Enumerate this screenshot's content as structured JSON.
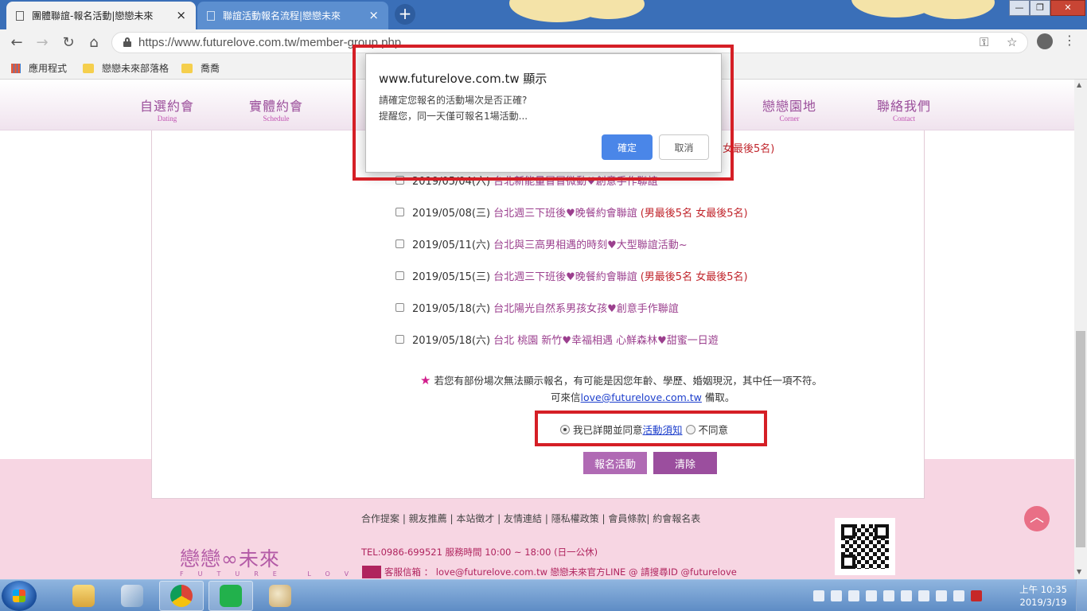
{
  "browser": {
    "tabs": [
      {
        "label": "團體聯誼-報名活動|戀戀未來",
        "active": true
      },
      {
        "label": "聯誼活動報名流程|戀戀未來",
        "active": false
      }
    ],
    "tab_close": "×",
    "new_tab": "+",
    "window_buttons": {
      "minimize": "—",
      "maximize": "❐",
      "close": "✕"
    },
    "url": "https://www.futurelove.com.tw/member-group.php",
    "bookmarks": [
      "應用程式",
      "戀戀未來部落格",
      "喬喬"
    ]
  },
  "nav": {
    "items": [
      {
        "zh": "自選約會",
        "en": "Dating"
      },
      {
        "zh": "實體約會",
        "en": "Schedule"
      },
      {
        "zh": "戀戀園地",
        "en": "Corner"
      },
      {
        "zh": "聯絡我們",
        "en": "Contact"
      }
    ]
  },
  "events": [
    {
      "date": "2019/05/04(六)",
      "title": "台北新能量冒冒微動♥創意手作聯誼",
      "note": ""
    },
    {
      "date": "2019/05/08(三)",
      "title": "台北週三下班後♥晚餐約會聯誼",
      "note": "(男最後5名 女最後5名)"
    },
    {
      "date": "2019/05/11(六)",
      "title": "台北與三高男相遇的時刻♥大型聯誼活動~",
      "note": ""
    },
    {
      "date": "2019/05/15(三)",
      "title": "台北週三下班後♥晚餐約會聯誼",
      "note": "(男最後5名 女最後5名)"
    },
    {
      "date": "2019/05/18(六)",
      "title": "台北陽光自然系男孩女孩♥創意手作聯誼",
      "note": ""
    },
    {
      "date": "2019/05/18(六)",
      "title": "台北 桃園 新竹♥幸福相遇 心鮮森林♥甜蜜一日遊",
      "note": ""
    }
  ],
  "overlap_note": "女最後5名)",
  "notice": {
    "star": "★",
    "line1": "若您有部份場次無法顯示報名，有可能是因您年齡、學歷、婚姻現況，其中任一項不符。",
    "line2_prefix": "可來信",
    "email": "love@futurelove.com.tw",
    "line2_suffix": " 備取。"
  },
  "agree": {
    "agree_label": "我已詳閱並同意",
    "terms_link": "活動須知",
    "disagree_label": "不同意",
    "selected": "agree"
  },
  "buttons": {
    "submit": "報名活動",
    "clear": "清除"
  },
  "footer": {
    "links": "合作提案 | 親友推薦 | 本站徵才 | 友情連結 | 隱私權政策 | 會員條款| 約會報名表",
    "brand": "戀戀∞未來",
    "brand_sub": "FUTURE LOVE",
    "tel": "TEL:0986-699521 服務時間 10:00 ~ 18:00 (日一公休)",
    "mail": "客服信箱 ： love@futurelove.com.tw    戀戀未來官方LINE @ 請搜尋ID @futurelove"
  },
  "dialog": {
    "title": "www.futurelove.com.tw 顯示",
    "message_line1": "請確定您報名的活動場次是否正確?",
    "message_line2": "提醒您，同一天僅可報名1場活動...",
    "ok": "確定",
    "cancel": "取消"
  },
  "taskbar": {
    "clock_time": "上午 10:35",
    "clock_date": "2019/3/19"
  },
  "colors": {
    "accent_purple": "#9b4e9e",
    "note_red": "#c0242b",
    "annotation_red": "#d51f26",
    "dialog_ok_blue": "#4a86e8"
  }
}
